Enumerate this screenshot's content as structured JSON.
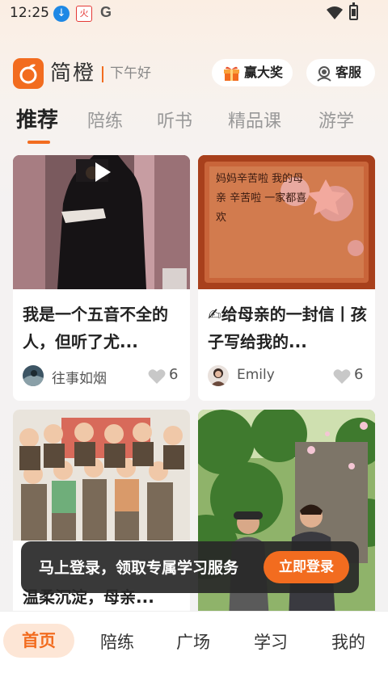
{
  "status_bar": {
    "time": "12:25",
    "download_icon": "download-icon",
    "app_icon_text": "火",
    "g_icon_text": "G"
  },
  "header": {
    "brand": "简橙",
    "greeting": "下午好",
    "prize_label": "赢大奖",
    "service_label": "客服"
  },
  "tabs": [
    {
      "label": "推荐",
      "active": true
    },
    {
      "label": "陪练"
    },
    {
      "label": "听书"
    },
    {
      "label": "精品课"
    },
    {
      "label": "游学"
    }
  ],
  "cards": [
    {
      "title": "我是一个五音不全的人，但听了尤...",
      "author": "往事如烟",
      "likes": "6",
      "has_video": true
    },
    {
      "title": "✍给母亲的一封信丨孩子写给我的...",
      "author": "Emily",
      "likes": "6",
      "media_text": "妈妈辛苦啦 我的母亲 辛苦啦 一家都喜欢",
      "has_video": false
    },
    {
      "title": "温柔沉淀，母亲...",
      "has_video": false
    },
    {
      "title": "",
      "has_video": false
    }
  ],
  "login_banner": {
    "text": "马上登录，领取专属学习服务",
    "button": "立即登录"
  },
  "bottom_nav": [
    {
      "label": "首页",
      "active": true
    },
    {
      "label": "陪练"
    },
    {
      "label": "广场"
    },
    {
      "label": "学习"
    },
    {
      "label": "我的"
    }
  ],
  "colors": {
    "accent": "#f26c1f",
    "banner_bg": "#282828"
  }
}
